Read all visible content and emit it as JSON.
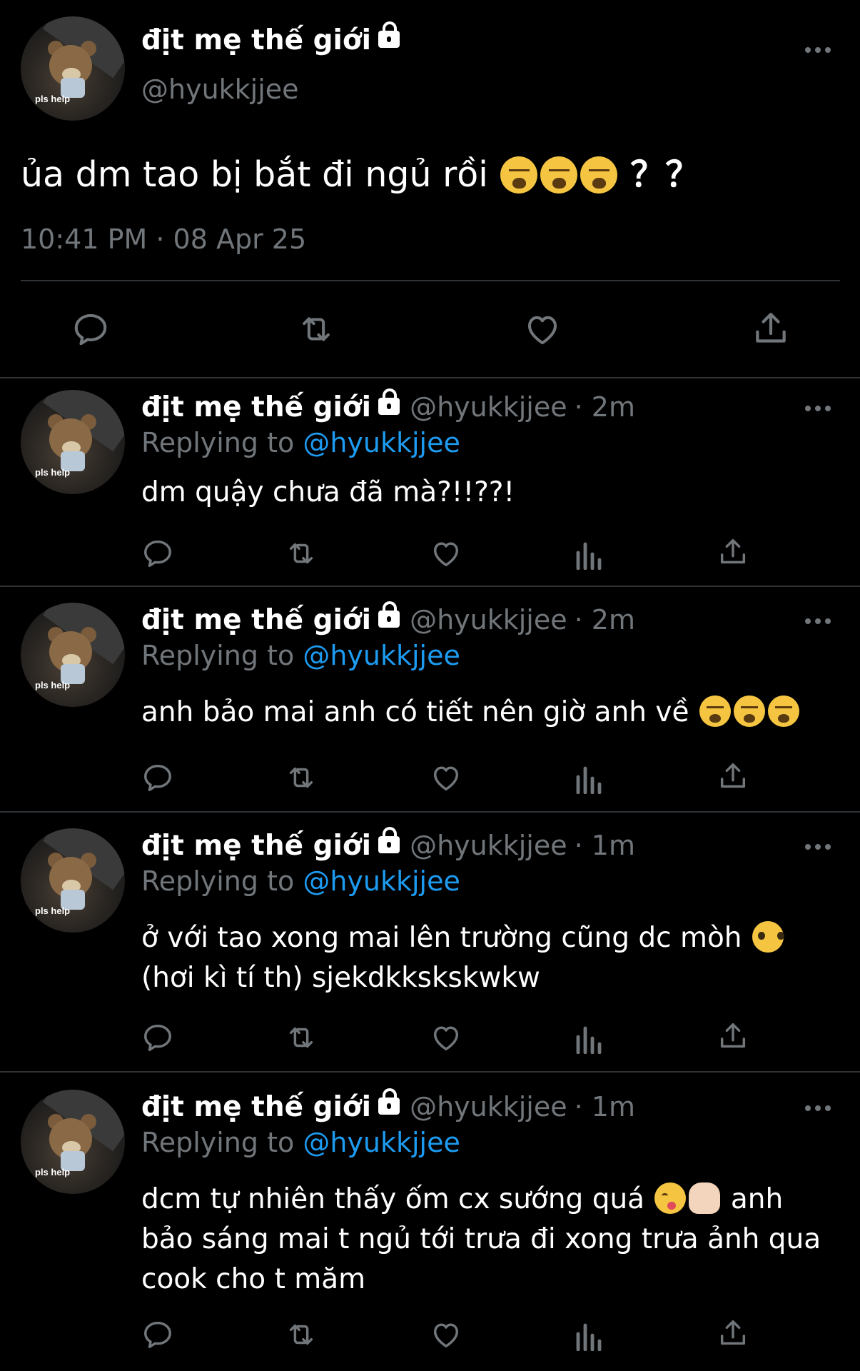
{
  "main_tweet": {
    "display_name": "địt mẹ thế giới",
    "handle": "@hyukkjjee",
    "avatar_tag": "pls help",
    "text": "ủa dm tao bị bắt đi ngủ rồi",
    "text_tail": "？？",
    "timestamp": "10:41 PM · 08 Apr 25"
  },
  "replies": [
    {
      "display_name": "địt mẹ thế giới",
      "handle": "@hyukkjjee",
      "time": "· 2m",
      "replying_prefix": "Replying to",
      "replying_to": "@hyukkjjee",
      "avatar_tag": "pls help",
      "text": "dm quậy chưa đã mà?!!??!"
    },
    {
      "display_name": "địt mẹ thế giới",
      "handle": "@hyukkjjee",
      "time": "· 2m",
      "replying_prefix": "Replying to",
      "replying_to": "@hyukkjjee",
      "avatar_tag": "pls help",
      "text": "anh bảo mai anh có tiết nên giờ anh về"
    },
    {
      "display_name": "địt mẹ thế giới",
      "handle": "@hyukkjjee",
      "time": "· 1m",
      "replying_prefix": "Replying to",
      "replying_to": "@hyukkjjee",
      "avatar_tag": "pls help",
      "text": "ở với tao xong mai lên trường cũng dc mòh",
      "text2": "(hơi kì tí th) sjekdkkskskwkw"
    },
    {
      "display_name": "địt mẹ thế giới",
      "handle": "@hyukkjjee",
      "time": "· 1m",
      "replying_prefix": "Replying to",
      "replying_to": "@hyukkjjee",
      "avatar_tag": "pls help",
      "text": "dcm tự nhiên thấy ốm cx sướng quá",
      "text_after": "anh",
      "text2": "bảo sáng mai t ngủ tới trưa đi xong trưa ảnh qua",
      "text3": "cook cho t măm"
    }
  ],
  "icons": {
    "reply": "reply-icon",
    "retweet": "retweet-icon",
    "like": "heart-icon",
    "views": "views-icon",
    "share": "share-icon",
    "more": "more-icon",
    "lock": "lock-icon"
  },
  "colors": {
    "background": "#000000",
    "text": "#ffffff",
    "secondary": "#71767b",
    "link": "#1d9bf0",
    "divider": "#2f3336"
  }
}
